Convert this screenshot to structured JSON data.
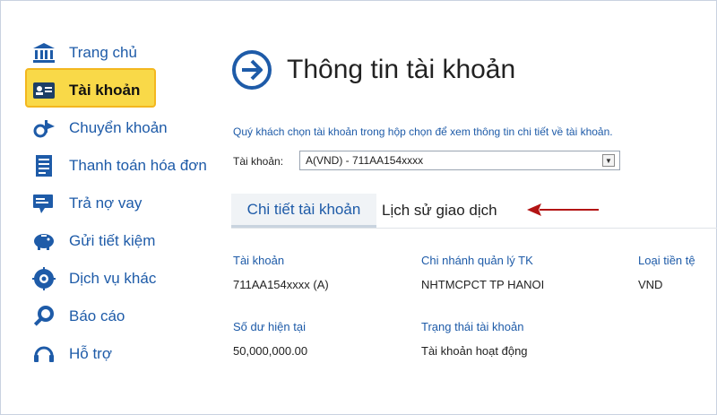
{
  "sidebar": {
    "items": [
      {
        "label": "Trang chủ",
        "icon": "bank-icon"
      },
      {
        "label": "Tài khoản",
        "icon": "account-card-icon",
        "active": true
      },
      {
        "label": "Chuyển khoản",
        "icon": "transfer-icon"
      },
      {
        "label": "Thanh toán hóa đơn",
        "icon": "bill-icon"
      },
      {
        "label": "Trả nợ vay",
        "icon": "loan-icon"
      },
      {
        "label": "Gửi tiết kiệm",
        "icon": "piggy-bank-icon"
      },
      {
        "label": "Dịch vụ khác",
        "icon": "services-icon"
      },
      {
        "label": "Báo cáo",
        "icon": "report-search-icon"
      },
      {
        "label": "Hỗ trợ",
        "icon": "headset-icon"
      }
    ]
  },
  "main": {
    "title": "Thông tin tài khoản",
    "instruction": "Quý khách chọn tài khoản trong hộp chọn để xem thông tin chi tiết về tài khoản.",
    "account_label": "Tài khoản:",
    "account_selected": "A(VND) - 711AA154xxxx",
    "tabs": [
      {
        "label": "Chi tiết tài khoản",
        "active": true
      },
      {
        "label": "Lịch sử giao dịch",
        "active": false
      }
    ],
    "details": {
      "account_label": "Tài khoản",
      "account_value": "711AA154xxxx (A)",
      "branch_label": "Chi nhánh quản lý TK",
      "branch_value": "NHTMCPCT TP HANOI",
      "currency_label": "Loại tiền tệ",
      "currency_value": "VND",
      "balance_label": "Số dư hiện tại",
      "balance_value": "50,000,000.00",
      "status_label": "Trạng thái tài khoản",
      "status_value": "Tài khoản hoạt động"
    }
  },
  "colors": {
    "nav_text": "#1e5ba8",
    "highlight": "#f9d948",
    "annotation_arrow": "#b31414"
  }
}
